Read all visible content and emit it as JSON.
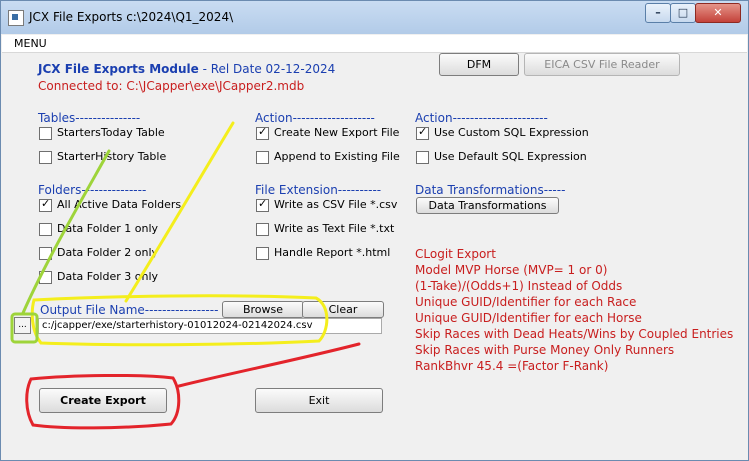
{
  "window": {
    "title": "JCX File Exports c:\\2024\\Q1_2024\\",
    "controls": {
      "minimize": "–",
      "maximize": "□",
      "close": "✕"
    }
  },
  "menu": {
    "label": "MENU"
  },
  "header": {
    "module_title": "JCX File Exports Module",
    "rel_date": " - Rel Date 02-12-2024",
    "connected": "Connected to: C:\\JCapper\\exe\\JCapper2.mdb"
  },
  "top_buttons": {
    "dfm": "DFM",
    "eica": "EICA CSV File Reader"
  },
  "tables": {
    "heading": "Tables---------------",
    "items": [
      {
        "label": "StartersToday Table",
        "checked": false
      },
      {
        "label": "StarterHistory Table",
        "checked": false
      }
    ]
  },
  "action1": {
    "heading": "Action-------------------",
    "items": [
      {
        "label": "Create New Export File",
        "checked": true
      },
      {
        "label": "Append to Existing File",
        "checked": false
      }
    ]
  },
  "action2": {
    "heading": "Action----------------------",
    "items": [
      {
        "label": "Use Custom SQL Expression",
        "checked": true
      },
      {
        "label": "Use Default SQL Expression",
        "checked": false
      }
    ]
  },
  "folders": {
    "heading": "Folders---------------",
    "items": [
      {
        "label": "All Active Data Folders",
        "checked": true
      },
      {
        "label": "Data Folder 1 only",
        "checked": false
      },
      {
        "label": "Data Folder 2 only",
        "checked": false
      },
      {
        "label": "Data Folder 3 only",
        "checked": false
      }
    ]
  },
  "file_extension": {
    "heading": "File Extension----------",
    "items": [
      {
        "label": "Write as CSV File  *.csv",
        "checked": true
      },
      {
        "label": "Write as Text File *.txt",
        "checked": false
      },
      {
        "label": "Handle Report *.html",
        "checked": false
      }
    ]
  },
  "data_transformations": {
    "heading": "Data Transformations-----",
    "button": "Data Transformations"
  },
  "output": {
    "label": "Output File Name-----------------",
    "browse": "Browse",
    "clear": "Clear",
    "value": "c:/jcapper/exe/starterhistory-01012024-02142024.csv",
    "dir_button": "..."
  },
  "clogit": [
    "CLogit Export",
    "Model MVP Horse (MVP= 1 or 0)",
    "(1-Take)/(Odds+1) Instead of Odds",
    "Unique GUID/Identifier for each Race",
    "Unique GUID/Identifier for each Horse",
    "Skip Races with Dead Heats/Wins by Coupled Entries",
    "Skip Races with Purse Money Only Runners",
    "RankBhvr 45.4 =(Factor F-Rank)"
  ],
  "bottom_buttons": {
    "create": "Create Export",
    "exit": "Exit"
  },
  "annotation_colors": {
    "yellow": "#f4ee1c",
    "green": "#9ed43a",
    "red": "#e3242b"
  }
}
